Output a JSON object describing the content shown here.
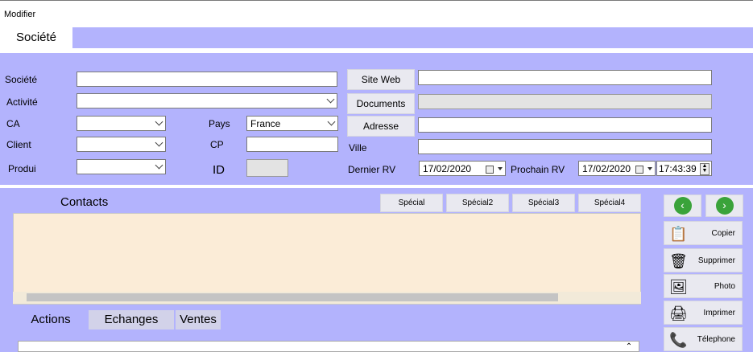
{
  "menu": {
    "modifier": "Modifier"
  },
  "tabs": {
    "societe": "Société"
  },
  "form": {
    "societe_label": "Société",
    "activite_label": "Activité",
    "ca_label": "CA",
    "client_label": "Client",
    "produi_label": "Produi",
    "pays_label": "Pays",
    "pays_value": "France",
    "cp_label": "CP",
    "id_label": "ID",
    "site_web_button": "Site Web",
    "documents_button": "Documents",
    "adresse_button": "Adresse",
    "ville_label": "Ville",
    "dernier_rv_label": "Dernier RV",
    "dernier_rv_value": "17/02/2020",
    "prochain_rv_label": "Prochain RV",
    "prochain_rv_value": "17/02/2020",
    "time_value": "17:43:39"
  },
  "contacts": {
    "title": "Contacts",
    "special_buttons": [
      "Spécial",
      "Spécial2",
      "Spécial3",
      "Spécial4"
    ]
  },
  "nav": {
    "prev_icon": "chevron-left-icon",
    "next_icon": "chevron-right-icon"
  },
  "side_buttons": [
    {
      "label": "Copier",
      "icon": "copy-icon"
    },
    {
      "label": "Supprimer",
      "icon": "trash-icon"
    },
    {
      "label": "Photo",
      "icon": "photo-icon"
    },
    {
      "label": "Imprimer",
      "icon": "printer-icon"
    },
    {
      "label": "Télephone",
      "icon": "phone-icon"
    }
  ],
  "bottom_tabs": [
    "Actions",
    "Echanges",
    "Ventes"
  ],
  "colors": {
    "panel": "#b3b3fd",
    "contacts_bg": "#fbecd7",
    "nav_green": "#3aa33a"
  }
}
